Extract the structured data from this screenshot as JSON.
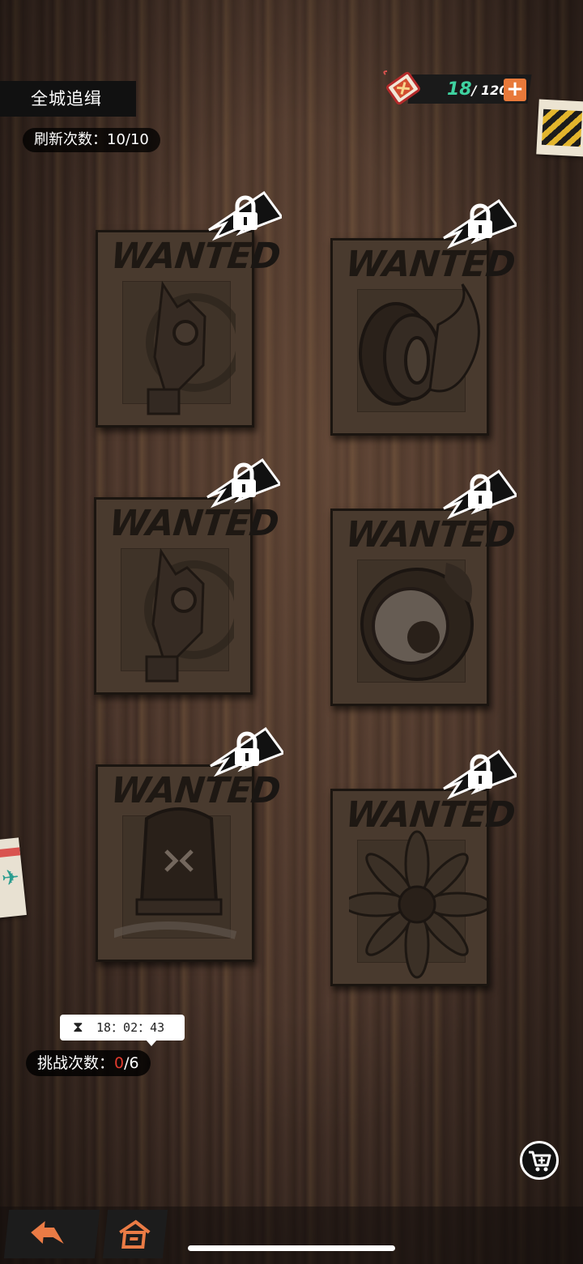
{
  "header": {
    "title": "全城追缉",
    "refresh_label": "刷新次数：10/10"
  },
  "resource": {
    "current": "18",
    "max": "/ 120",
    "icon": "ticket-icon",
    "plus_icon": "plus-icon"
  },
  "posters": [
    {
      "title": "WANTED",
      "icon": "gas-mask-icon",
      "locked": true
    },
    {
      "title": "WANTED",
      "icon": "flaming-tire-icon",
      "locked": true
    },
    {
      "title": "WANTED",
      "icon": "gas-mask-icon",
      "locked": true
    },
    {
      "title": "WANTED",
      "icon": "eyeball-icon",
      "locked": true
    },
    {
      "title": "WANTED",
      "icon": "siren-light-icon",
      "locked": true
    },
    {
      "title": "WANTED",
      "icon": "sunflower-icon",
      "locked": true
    }
  ],
  "timer": {
    "icon": "hourglass-icon",
    "value": "18：02：43"
  },
  "challenge": {
    "label": "挑战次数：",
    "used": "0",
    "total": "/6"
  },
  "colors": {
    "resource_current": "#3fd2a0",
    "accent_orange": "#e8793a",
    "used_red": "#e23b2e"
  },
  "nav": {
    "back_icon": "back-arrow-icon",
    "home_icon": "home-icon",
    "shop_icon": "cart-plus-icon"
  }
}
